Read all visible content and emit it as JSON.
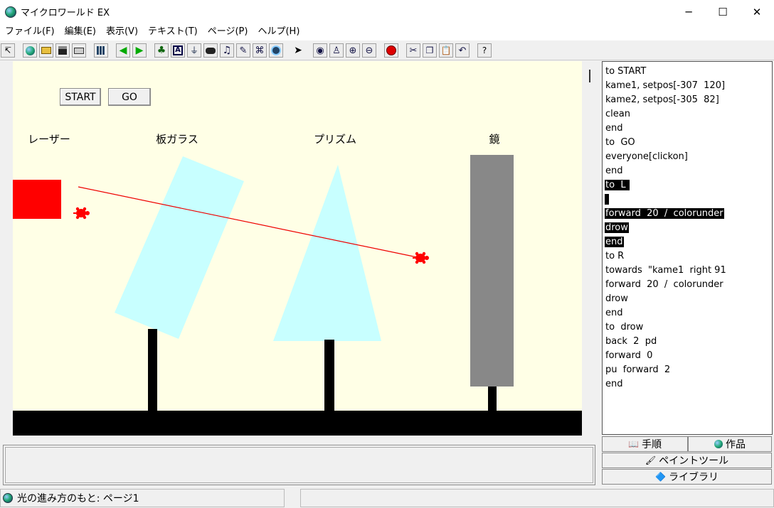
{
  "window": {
    "title": "マイクロワールド EX",
    "controls": {
      "minimize": "─",
      "maximize": "☐",
      "close": "✕"
    }
  },
  "menu": [
    "ファイル(F)",
    "編集(E)",
    "表示(V)",
    "テキスト(T)",
    "ページ(P)",
    "ヘルプ(H)"
  ],
  "toolbar": {
    "icons": [
      "cursor-icon",
      "globe-icon",
      "open-folder-icon",
      "save-icon",
      "print-icon",
      "grid-icon",
      "arrow-left-icon",
      "arrow-right-icon",
      "turtle-hatch-icon",
      "text-box-icon",
      "slider-icon",
      "button-icon",
      "music-icon",
      "paint-icon",
      "video-icon",
      "web-icon",
      "pointer-icon",
      "eye-icon",
      "stamp-icon",
      "zoom-in-icon",
      "zoom-out-icon",
      "stop-icon",
      "cut-icon",
      "copy-icon",
      "paste-icon",
      "undo-icon",
      "help-icon"
    ],
    "help_label": "?"
  },
  "canvas": {
    "background": "#ffffe6",
    "buttons": {
      "start": "START",
      "go": "GO"
    },
    "labels": {
      "laser": "レーザー",
      "glass": "板ガラス",
      "prism": "プリズム",
      "mirror": "鏡"
    },
    "colors": {
      "laser": "#ff0000",
      "glass": "#c8ffff",
      "mirror": "#888888",
      "ground": "#000000",
      "turtle": "#ff0000"
    }
  },
  "script": {
    "lines": [
      {
        "text": "to START",
        "selected": false
      },
      {
        "text": "kame1, setpos[-307  120]",
        "selected": false
      },
      {
        "text": "kame2, setpos[-305  82]",
        "selected": false
      },
      {
        "text": "clean",
        "selected": false
      },
      {
        "text": "end",
        "selected": false
      },
      {
        "text": "to  GO",
        "selected": false
      },
      {
        "text": "everyone[clickon]",
        "selected": false
      },
      {
        "text": "end",
        "selected": false
      },
      {
        "text": "to  L ",
        "selected": true
      },
      {
        "text": " ",
        "selected": true
      },
      {
        "text": "forward  20  /  colorunder",
        "selected": true
      },
      {
        "text": "drow",
        "selected": true
      },
      {
        "text": "end",
        "selected": true
      },
      {
        "text": "to R",
        "selected": false
      },
      {
        "text": "towards  \"kame1  right 91",
        "selected": false
      },
      {
        "text": "forward  20  /  colorunder",
        "selected": false
      },
      {
        "text": "drow",
        "selected": false
      },
      {
        "text": "end",
        "selected": false
      },
      {
        "text": "to  drow",
        "selected": false
      },
      {
        "text": "back  2  pd",
        "selected": false
      },
      {
        "text": "forward  0",
        "selected": false
      },
      {
        "text": "pu  forward  2",
        "selected": false
      },
      {
        "text": "end",
        "selected": false
      }
    ]
  },
  "tabs": {
    "procedures": "手順",
    "project": "作品",
    "paint_tools": "ペイントツール",
    "library": "ライブラリ"
  },
  "status": {
    "project_page": "光の進み方のもと: ページ1"
  }
}
